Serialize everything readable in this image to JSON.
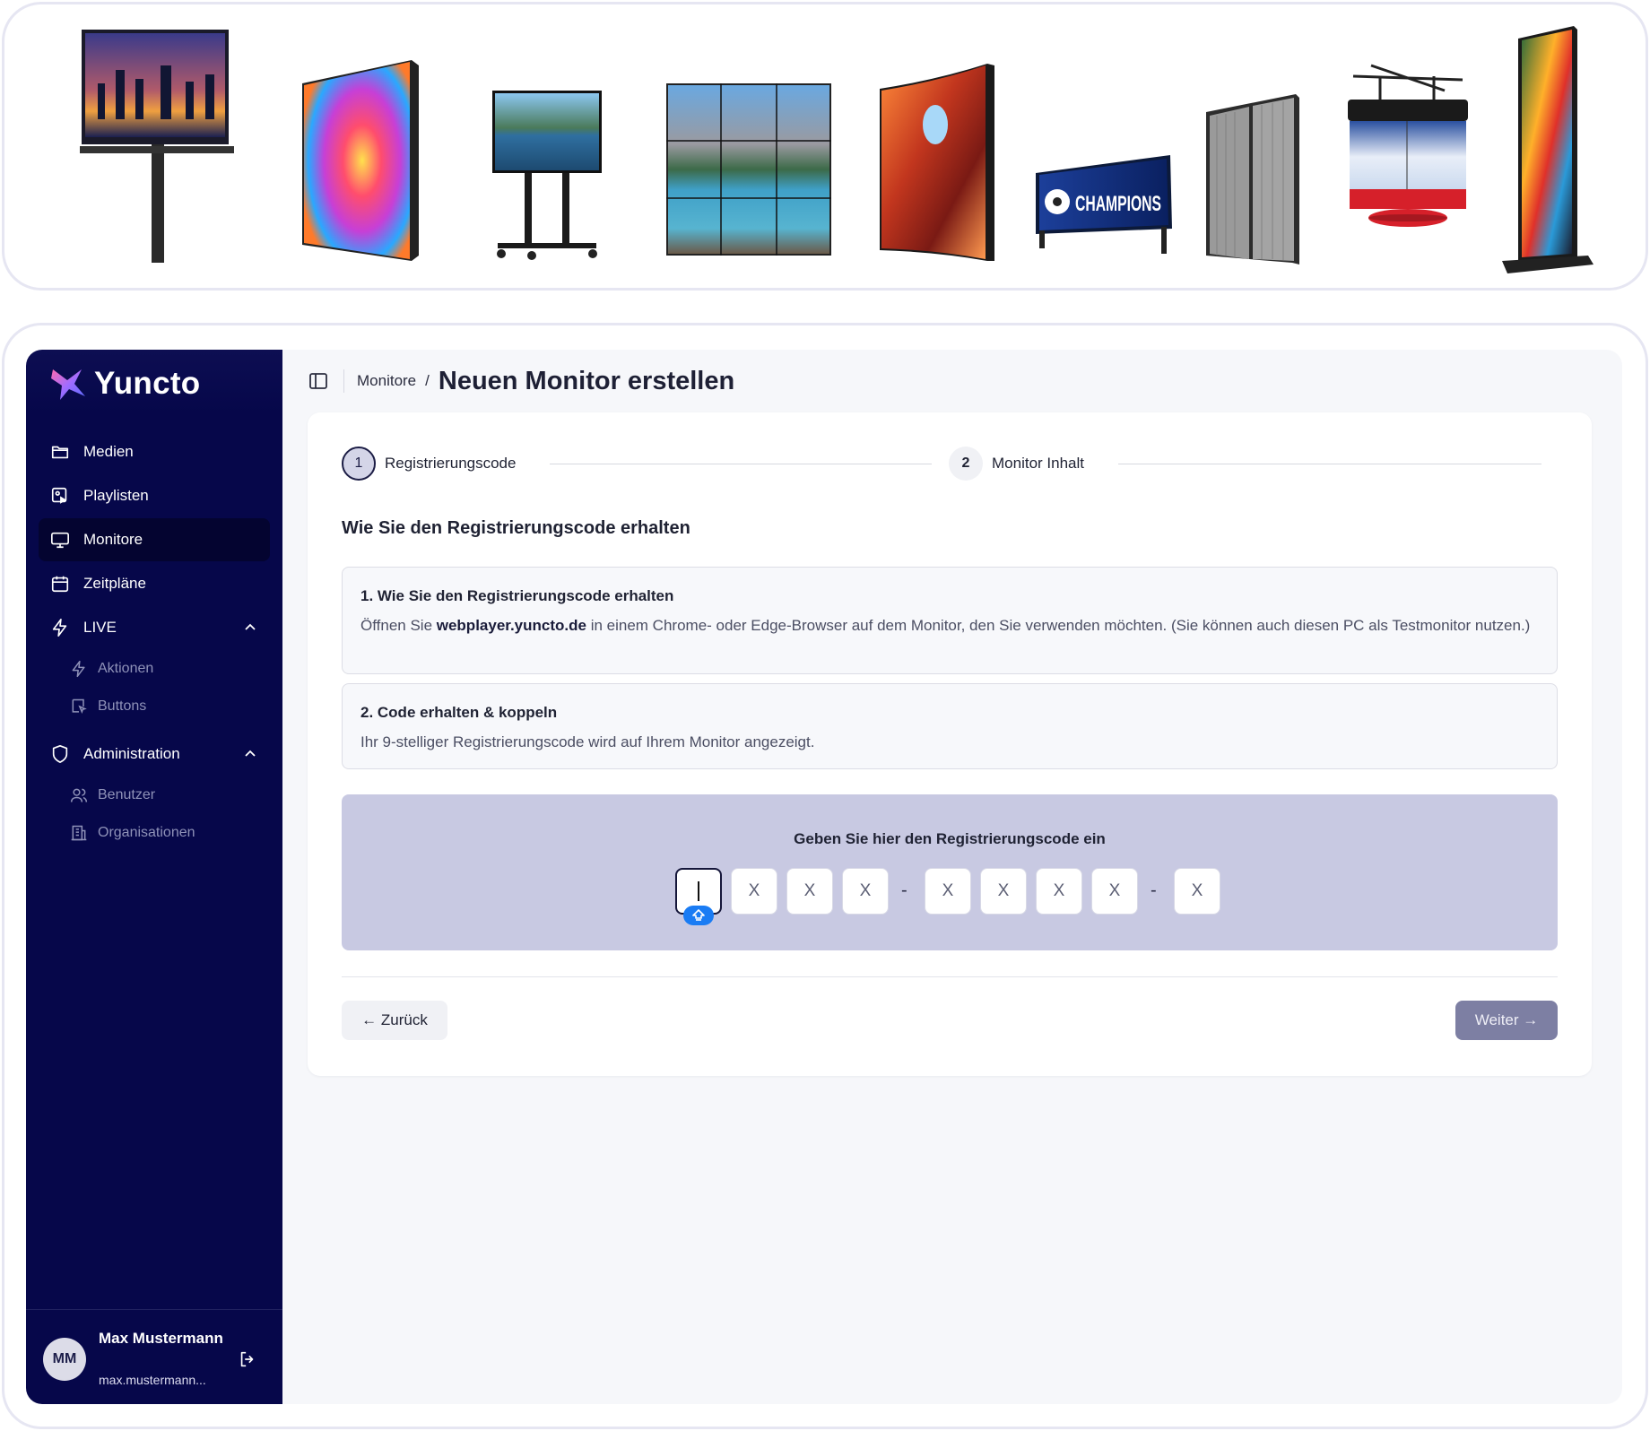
{
  "brand": {
    "name": "Yuncto",
    "accent": "#0b0c4f"
  },
  "gallery": {
    "overlay_text": "CHAMPIONS",
    "items": [
      "billboard",
      "led-cabinet",
      "tv-stand",
      "video-wall",
      "curved-led",
      "stadium-banner",
      "transparent-led",
      "hanging-cube",
      "led-totem"
    ]
  },
  "sidebar": {
    "items": [
      {
        "label": "Medien",
        "icon": "folder-icon"
      },
      {
        "label": "Playlisten",
        "icon": "playlist-icon"
      },
      {
        "label": "Monitore",
        "icon": "monitor-icon",
        "active": true
      },
      {
        "label": "Zeitpläne",
        "icon": "calendar-icon"
      },
      {
        "label": "LIVE",
        "icon": "lightning-icon",
        "expanded": true,
        "children": [
          {
            "label": "Aktionen",
            "icon": "lightning-icon"
          },
          {
            "label": "Buttons",
            "icon": "pointer-icon"
          }
        ]
      },
      {
        "label": "Administration",
        "icon": "shield-icon",
        "expanded": true,
        "children": [
          {
            "label": "Benutzer",
            "icon": "users-icon"
          },
          {
            "label": "Organisationen",
            "icon": "building-icon"
          }
        ]
      }
    ],
    "user": {
      "initials": "MM",
      "name": "Max Mustermann",
      "email": "max.mustermann..."
    }
  },
  "header": {
    "breadcrumb_parent": "Monitore",
    "separator": "/",
    "title": "Neuen Monitor erstellen"
  },
  "stepper": {
    "steps": [
      {
        "number": "1",
        "label": "Registrierungscode",
        "active": true
      },
      {
        "number": "2",
        "label": "Monitor Inhalt",
        "active": false
      }
    ]
  },
  "content": {
    "section_title": "Wie Sie den Registrierungscode erhalten",
    "info1": {
      "title": "1. Wie Sie den Registrierungscode erhalten",
      "text_before": "Öffnen Sie ",
      "link": "webplayer.yuncto.de",
      "text_after": " in einem Chrome- oder Edge-Browser auf dem Monitor, den Sie verwenden möchten. (Sie können auch diesen PC als Testmonitor nutzen.)"
    },
    "info2": {
      "title": "2. Code erhalten & koppeln",
      "text": "Ihr 9-stelliger Registrierungscode wird auf Ihrem Monitor angezeigt."
    },
    "code": {
      "title": "Geben Sie hier den Registrierungscode ein",
      "placeholder": "X",
      "separator": "-",
      "cells": [
        "",
        "X",
        "X",
        "X",
        "X",
        "X",
        "X",
        "X",
        "X"
      ]
    }
  },
  "buttons": {
    "back": "← Zurück",
    "next": "Weiter →"
  }
}
